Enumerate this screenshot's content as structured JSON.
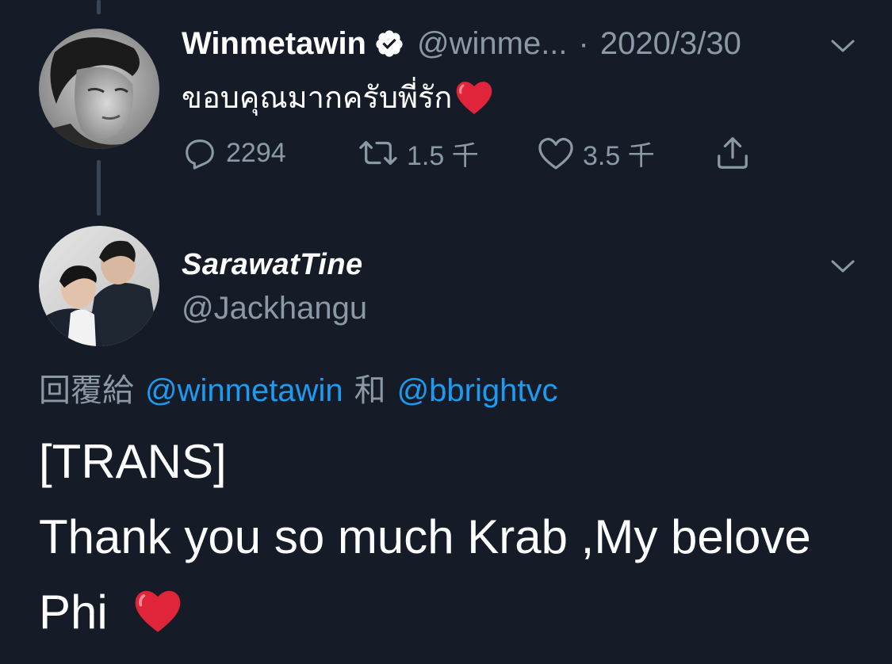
{
  "colors": {
    "background": "#151c28",
    "muted": "#8b98a5",
    "link": "#1d9bf0",
    "heart": "#e0243a"
  },
  "tweet1": {
    "name": "Winmetawin",
    "handle": "@winme...",
    "separator": "·",
    "date": "2020/3/30",
    "text": "ขอบคุณมากครับพี่รัก",
    "text_emoji": "red-heart-icon",
    "actions": {
      "reply_count": "2294",
      "retweet_count": "1.5 千",
      "like_count": "3.5 千"
    }
  },
  "tweet2": {
    "name": "SarawatTine",
    "handle": "@Jackhangu",
    "reply_prefix": "回覆給",
    "mention1": "@winmetawin",
    "conjunction": "和",
    "mention2": "@bbrightvc",
    "body_line1": "[TRANS]",
    "body_line2": "Thank you so much Krab ,My belove",
    "body_line3": "Phi",
    "body_emoji": "red-heart-icon"
  }
}
